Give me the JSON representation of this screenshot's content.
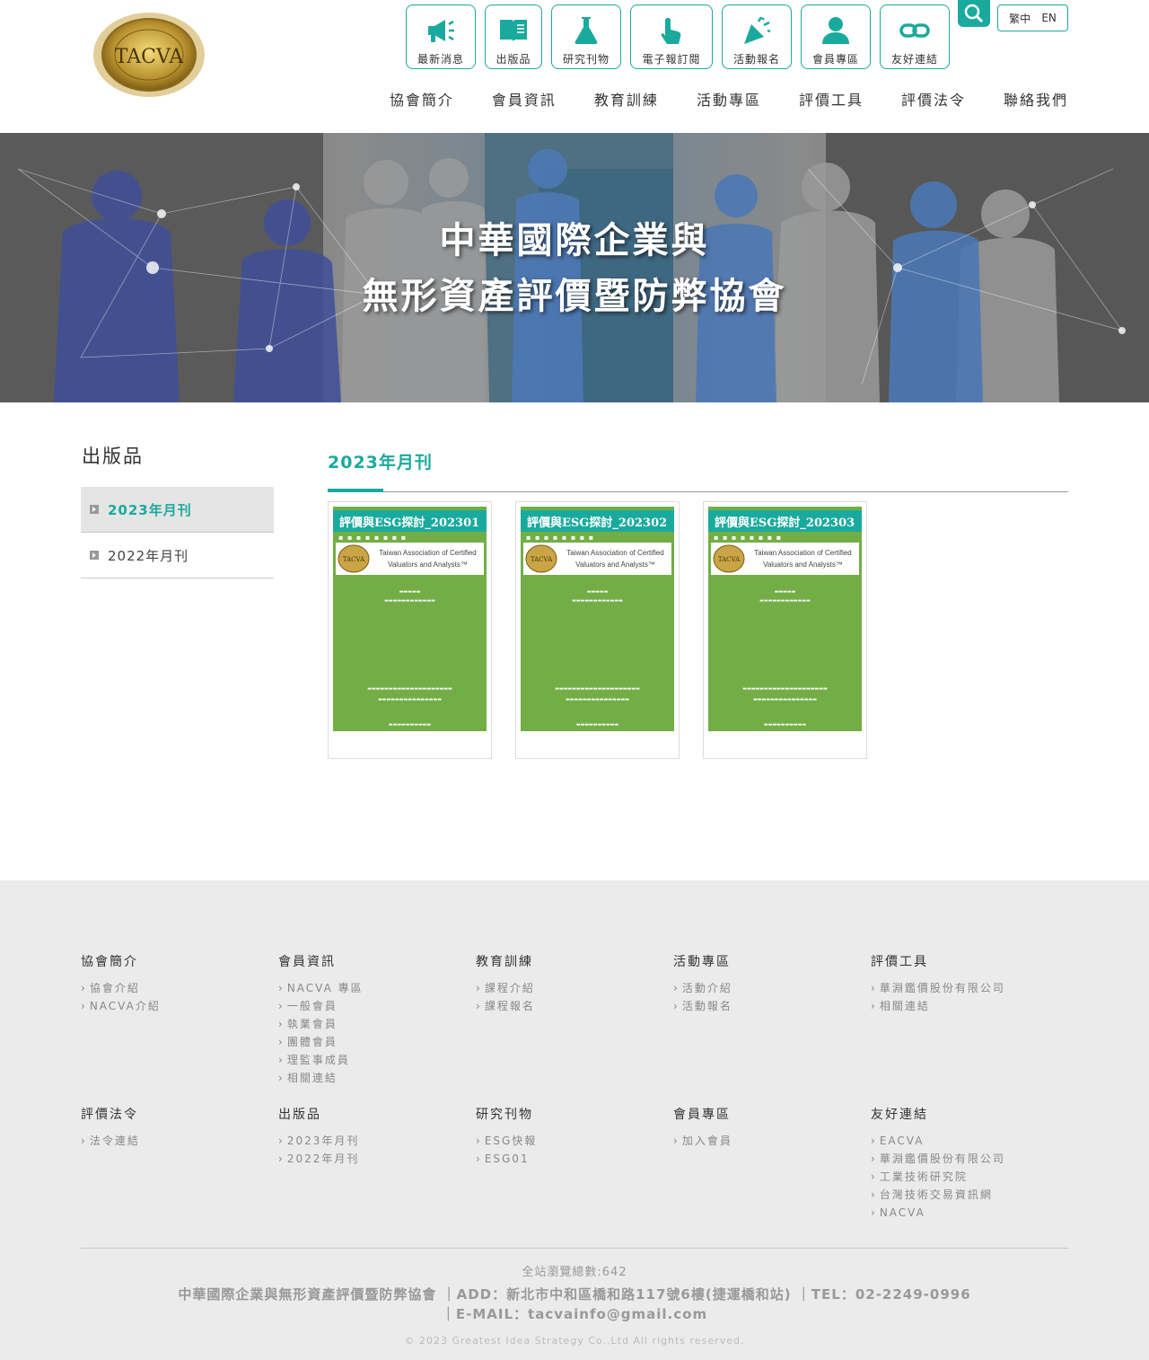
{
  "header": {
    "logo_text": "TACVA",
    "icons": [
      {
        "label": "最新消息",
        "icon": "megaphone-icon"
      },
      {
        "label": "出版品",
        "icon": "book-icon"
      },
      {
        "label": "研究刊物",
        "icon": "flask-icon"
      },
      {
        "label": "電子報訂閱",
        "icon": "tap-hand-icon"
      },
      {
        "label": "活動報名",
        "icon": "party-popper-icon"
      },
      {
        "label": "會員專區",
        "icon": "user-icon"
      },
      {
        "label": "友好連結",
        "icon": "link-icon"
      }
    ],
    "lang_zh": "繁中",
    "lang_en": "EN",
    "nav": [
      "協會簡介",
      "會員資訊",
      "教育訓練",
      "活動專區",
      "評價工具",
      "評價法令",
      "聯絡我們"
    ]
  },
  "banner": {
    "line1": "中華國際企業與",
    "line2": "無形資產評價暨防弊協會"
  },
  "sidebar": {
    "title": "出版品",
    "items": [
      {
        "label": "2023年月刊",
        "active": true
      },
      {
        "label": "2022年月刊",
        "active": false
      }
    ]
  },
  "main": {
    "heading": "2023年月刊",
    "cards": [
      {
        "title": "評價與ESG探討_202301"
      },
      {
        "title": "評價與ESG探討_202302"
      },
      {
        "title": "評價與ESG探討_202303"
      }
    ],
    "cover_box_line1": "Taiwan Association of Certified",
    "cover_box_line2": "Valuators and Analysts™"
  },
  "footer": {
    "columns": [
      {
        "title": "協會簡介",
        "links": [
          "協會介紹",
          "NACVA介紹"
        ]
      },
      {
        "title": "會員資訊",
        "links": [
          "NACVA 專區",
          "一般會員",
          "執業會員",
          "團體會員",
          "理監事成員",
          "相關連結"
        ]
      },
      {
        "title": "教育訓練",
        "links": [
          "課程介紹",
          "課程報名"
        ]
      },
      {
        "title": "活動專區",
        "links": [
          "活動介紹",
          "活動報名"
        ]
      },
      {
        "title": "評價工具",
        "links": [
          "華淵鑑價股份有限公司",
          "相關連結"
        ]
      },
      {
        "title": "評價法令",
        "links": [
          "法令連結"
        ]
      },
      {
        "title": "出版品",
        "links": [
          "2023年月刊",
          "2022年月刊"
        ]
      },
      {
        "title": "研究刊物",
        "links": [
          "ESG快報",
          "ESG01"
        ]
      },
      {
        "title": "會員專區",
        "links": [
          "加入會員"
        ]
      },
      {
        "title": "友好連結",
        "links": [
          "EACVA",
          "華淵鑑價股份有限公司",
          "工業技術研究院",
          "台灣技術交易資訊網",
          "NACVA"
        ]
      }
    ],
    "visits": "全站瀏覽總數:642",
    "info_line1": "中華國際企業與無形資產評價暨防弊協會 ｜ADD：新北市中和區橋和路117號6樓(捷運橋和站) ｜TEL：02-2249-0996",
    "info_line2": "｜E-MAIL：tacvainfo@gmail.com",
    "copyright": "© 2023 Greatest Idea Strategy Co.,Ltd All rights reserved."
  },
  "colors": {
    "accent": "#1aaa9d",
    "cover_green": "#72ae45",
    "footer_bg": "#ebebeb"
  }
}
